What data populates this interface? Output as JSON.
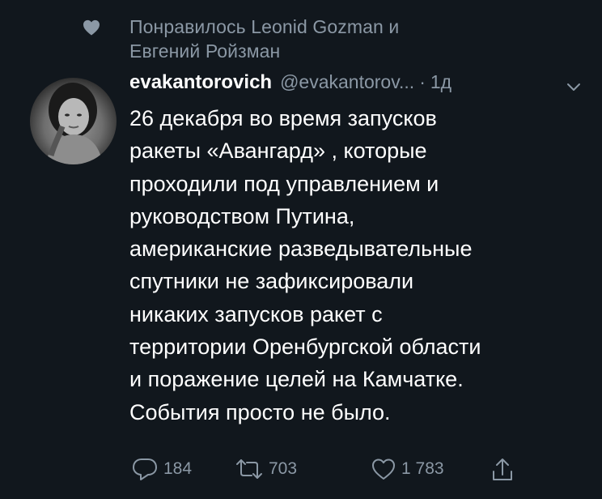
{
  "liked_by": {
    "line1": "Понравилось Leonid Gozman и",
    "line2": "Евгений Ройзман"
  },
  "tweet": {
    "display_name": "evakantorovich",
    "handle": "@evakantorov...",
    "separator": "·",
    "time": "1д",
    "lines": [
      "26 декабря во время  запусков",
      "ракеты «Авангард» , которые",
      "проходили под управлением и",
      "руководством Путина,",
      "американские разведывательные",
      "спутники не зафиксировали",
      "никаких запусков ракет с",
      "территории Оренбургской области",
      "и поражение целей на Камчатке.",
      "События просто не было."
    ]
  },
  "actions": {
    "replies": "184",
    "retweets": "703",
    "likes": "1 783"
  },
  "icons": {
    "liked_indicator": "heart-icon",
    "reply": "reply-icon",
    "retweet": "retweet-icon",
    "like": "heart-outline-icon",
    "share": "share-icon",
    "menu": "chevron-down-icon"
  },
  "colors": {
    "background": "#11171d",
    "text_primary": "#ffffff",
    "text_secondary": "#8b98a5"
  }
}
